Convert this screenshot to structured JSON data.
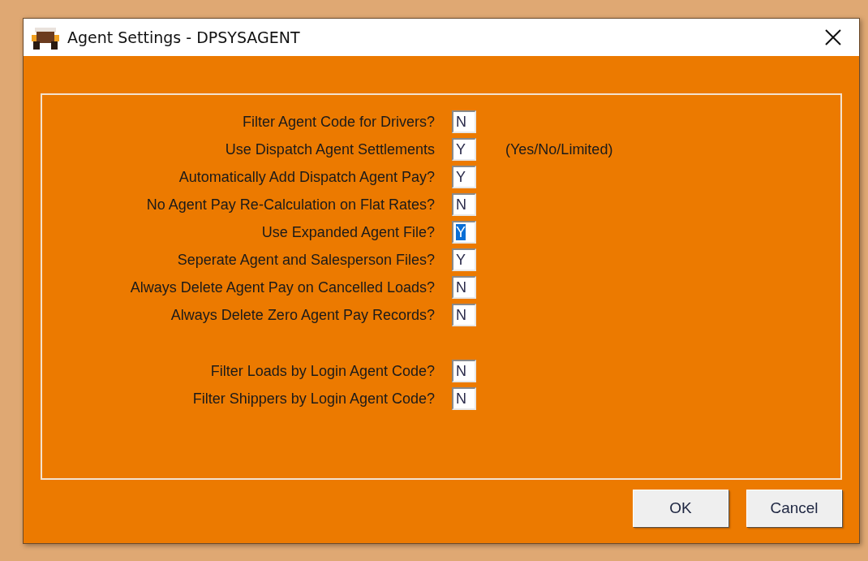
{
  "window": {
    "title": "Agent Settings - DPSYSAGENT"
  },
  "settings": [
    {
      "label": "Filter Agent Code for Drivers?",
      "value": "N",
      "selected": false
    },
    {
      "label": "Use Dispatch Agent Settlements",
      "value": "Y",
      "selected": false,
      "hint": "(Yes/No/Limited)"
    },
    {
      "label": "Automatically Add Dispatch Agent Pay?",
      "value": "Y",
      "selected": false
    },
    {
      "label": "No Agent Pay Re-Calculation on Flat Rates?",
      "value": "N",
      "selected": false
    },
    {
      "label": "Use Expanded Agent File?",
      "value": "Y",
      "selected": true
    },
    {
      "label": "Seperate Agent and Salesperson Files?",
      "value": "Y",
      "selected": false
    },
    {
      "label": "Always Delete Agent Pay on Cancelled Loads?",
      "value": "N",
      "selected": false
    },
    {
      "label": "Always Delete Zero Agent Pay Records?",
      "value": "N",
      "selected": false
    }
  ],
  "login_filters": [
    {
      "label": "Filter Loads by Login Agent Code?",
      "value": "N",
      "selected": false
    },
    {
      "label": "Filter Shippers by Login Agent Code?",
      "value": "N",
      "selected": false
    }
  ],
  "buttons": [
    "OK",
    "Cancel"
  ]
}
